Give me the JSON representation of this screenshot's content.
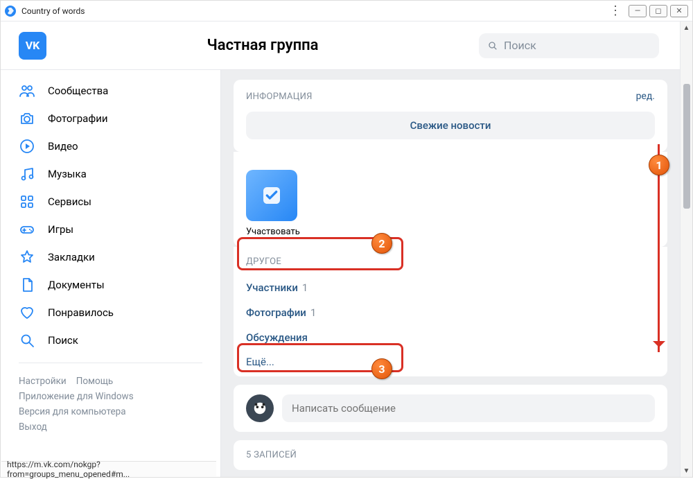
{
  "window": {
    "title": "Country of words"
  },
  "header": {
    "logo_text": "VK",
    "page_title": "Частная группа",
    "search_placeholder": "Поиск"
  },
  "sidebar": {
    "items": [
      {
        "label": "Сообщества"
      },
      {
        "label": "Фотографии"
      },
      {
        "label": "Видео"
      },
      {
        "label": "Музыка"
      },
      {
        "label": "Сервисы"
      },
      {
        "label": "Игры"
      },
      {
        "label": "Закладки"
      },
      {
        "label": "Документы"
      },
      {
        "label": "Понравилось"
      },
      {
        "label": "Поиск"
      }
    ],
    "footer": {
      "settings": "Настройки",
      "help": "Помощь",
      "windows_app": "Приложение для Windows",
      "desktop_version": "Версия для компьютера",
      "logout": "Выход"
    }
  },
  "main": {
    "info": {
      "title": "ИНФОРМАЦИЯ",
      "edit": "ред.",
      "news_button": "Свежие новости"
    },
    "participate": {
      "label": "Участвовать"
    },
    "other": {
      "title": "ДРУГОЕ",
      "members_label": "Участники",
      "members_count": "1",
      "photos_label": "Фотографии",
      "photos_count": "1",
      "discussions_label": "Обсуждения",
      "more_label": "Ещё..."
    },
    "compose": {
      "placeholder": "Написать сообщение"
    },
    "posts": {
      "title": "5 ЗАПИСЕЙ"
    }
  },
  "statusbar": {
    "url": "https://m.vk.com/nokgp?from=groups_menu_opened#m..."
  },
  "annotations": {
    "n1": "1",
    "n2": "2",
    "n3": "3"
  }
}
